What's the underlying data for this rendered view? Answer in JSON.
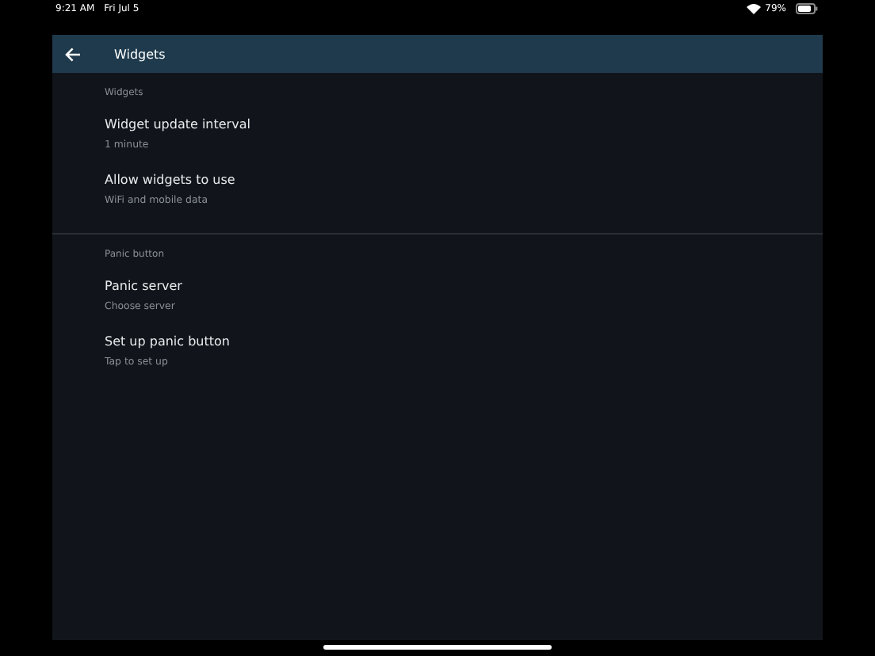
{
  "status_bar": {
    "time": "9:21 AM",
    "date": "Fri Jul 5",
    "battery": "79%"
  },
  "header": {
    "title": "Widgets"
  },
  "sections": [
    {
      "title": "Widgets",
      "items": [
        {
          "title": "Widget update interval",
          "subtitle": "1 minute"
        },
        {
          "title": "Allow widgets to use",
          "subtitle": "WiFi and mobile data"
        }
      ]
    },
    {
      "title": "Panic button",
      "items": [
        {
          "title": "Panic server",
          "subtitle": "Choose server"
        },
        {
          "title": "Set up panic button",
          "subtitle": "Tap to set up"
        }
      ]
    }
  ]
}
